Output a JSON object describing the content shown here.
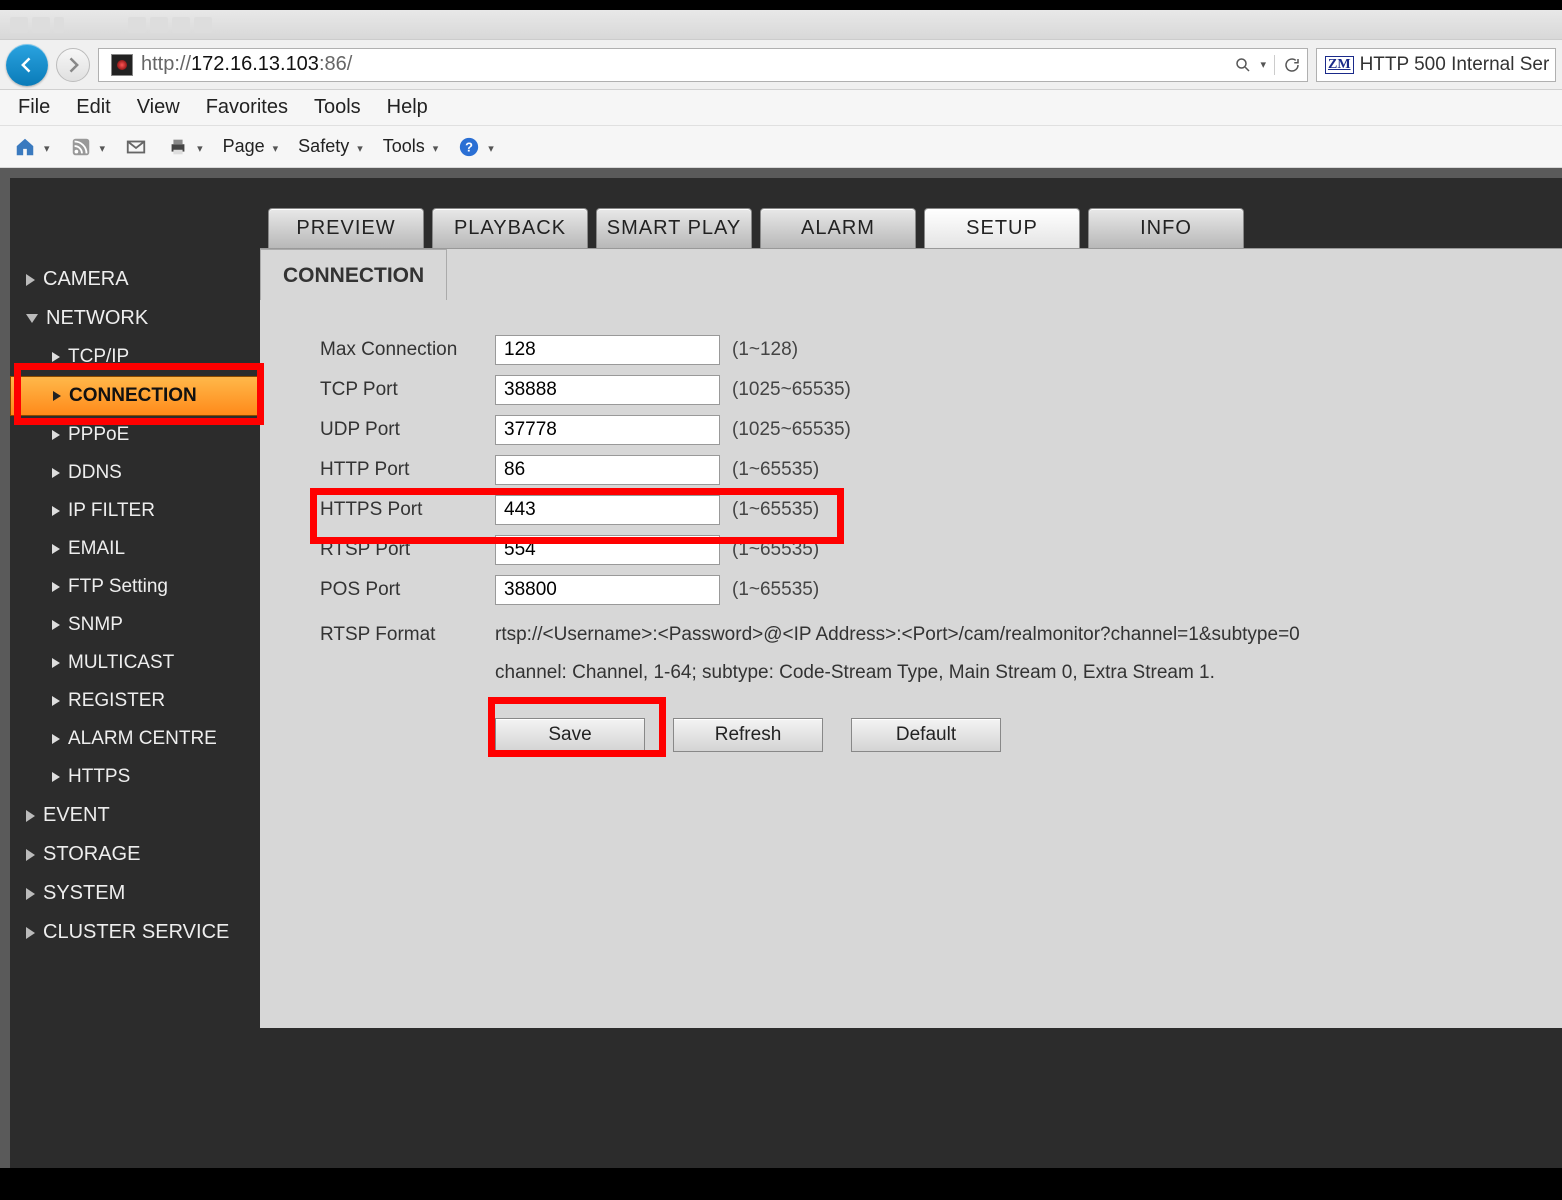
{
  "browser": {
    "url_prefix": "http://",
    "url_host": "172.16.13.103",
    "url_suffix": ":86/",
    "tab_title": "HTTP 500 Internal Ser",
    "tab_badge": "ZM"
  },
  "menubar": [
    "File",
    "Edit",
    "View",
    "Favorites",
    "Tools",
    "Help"
  ],
  "toolbar": {
    "page": "Page",
    "safety": "Safety",
    "tools": "Tools"
  },
  "tabs": [
    "PREVIEW",
    "PLAYBACK",
    "SMART PLAY",
    "ALARM",
    "SETUP",
    "INFO"
  ],
  "activeTab": "SETUP",
  "sidebar": {
    "camera": "CAMERA",
    "network": "NETWORK",
    "network_items": [
      "TCP/IP",
      "CONNECTION",
      "PPPoE",
      "DDNS",
      "IP FILTER",
      "EMAIL",
      "FTP Setting",
      "SNMP",
      "MULTICAST",
      "REGISTER",
      "ALARM CENTRE",
      "HTTPS"
    ],
    "event": "EVENT",
    "storage": "STORAGE",
    "system": "SYSTEM",
    "cluster": "CLUSTER SERVICE"
  },
  "content": {
    "subtab": "CONNECTION",
    "fields": [
      {
        "label": "Max Connection",
        "value": "128",
        "hint": "(1~128)"
      },
      {
        "label": "TCP Port",
        "value": "38888",
        "hint": "(1025~65535)"
      },
      {
        "label": "UDP Port",
        "value": "37778",
        "hint": "(1025~65535)"
      },
      {
        "label": "HTTP Port",
        "value": "86",
        "hint": "(1~65535)"
      },
      {
        "label": "HTTPS Port",
        "value": "443",
        "hint": "(1~65535)"
      },
      {
        "label": "RTSP Port",
        "value": "554",
        "hint": "(1~65535)"
      },
      {
        "label": "POS Port",
        "value": "38800",
        "hint": "(1~65535)"
      }
    ],
    "rtsp_label": "RTSP Format",
    "rtsp_line1": "rtsp://<Username>:<Password>@<IP Address>:<Port>/cam/realmonitor?channel=1&subtype=0",
    "rtsp_line2": "channel: Channel, 1-64; subtype: Code-Stream Type, Main Stream 0, Extra Stream 1.",
    "buttons": {
      "save": "Save",
      "refresh": "Refresh",
      "default": "Default"
    }
  }
}
